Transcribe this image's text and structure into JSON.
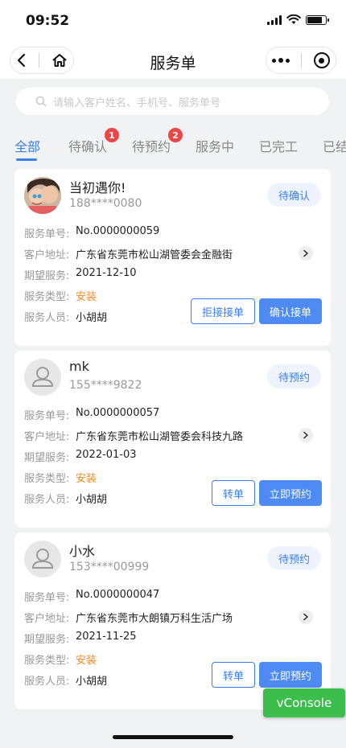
{
  "status_bar": {
    "time": "09:52"
  },
  "nav": {
    "title": "服务单"
  },
  "search": {
    "placeholder": "请输入客户姓名、手机号、服务单号"
  },
  "tabs": [
    {
      "label": "全部"
    },
    {
      "label": "待确认",
      "badge": "1"
    },
    {
      "label": "待预约",
      "badge": "2"
    },
    {
      "label": "服务中"
    },
    {
      "label": "已完工"
    },
    {
      "label": "已结"
    }
  ],
  "field_labels": {
    "order_no": "服务单号:",
    "address": "客户地址:",
    "expected": "期望服务:",
    "type": "服务类型:",
    "staff": "服务人员:"
  },
  "orders": [
    {
      "name": "当初遇你!",
      "phone": "188****0080",
      "status": "待确认",
      "order_no": "No.0000000059",
      "address": "广东省东莞市松山湖管委会金融街",
      "expected": "2021-12-10",
      "type": "安装",
      "staff": "小胡胡",
      "btn_secondary": "拒接接单",
      "btn_primary": "确认接单"
    },
    {
      "name": "mk",
      "phone": "155****9822",
      "status": "待预约",
      "order_no": "No.0000000057",
      "address": "广东省东莞市松山湖管委会科技九路",
      "expected": "2022-01-03",
      "type": "安装",
      "staff": "小胡胡",
      "btn_secondary": "转单",
      "btn_primary": "立即预约"
    },
    {
      "name": "小水",
      "phone": "153****00999",
      "status": "待预约",
      "order_no": "No.0000000047",
      "address": "广东省东莞市大朗镇万科生活广场",
      "expected": "2021-11-25",
      "type": "安装",
      "staff": "小胡胡",
      "btn_secondary": "转单",
      "btn_primary": "立即预约"
    }
  ],
  "vconsole": {
    "label": "vConsole"
  },
  "colors": {
    "accent": "#3a7ef0",
    "badge": "#ee4646",
    "service_type": "#f08a24",
    "vconsole": "#3dbd4b"
  }
}
